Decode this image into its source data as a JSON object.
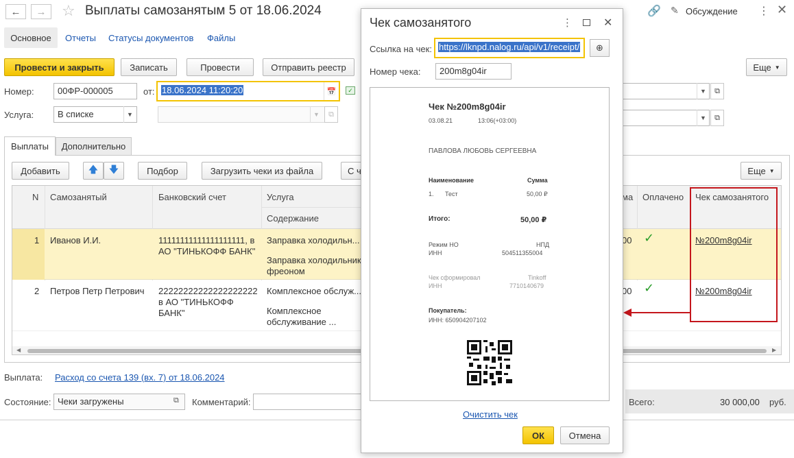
{
  "window": {
    "title": "Выплаты самозанятым 5 от 18.06.2024",
    "discussion_label": "Обсуждение"
  },
  "nav_tabs": [
    "Основное",
    "Отчеты",
    "Статусы документов",
    "Файлы"
  ],
  "toolbar": {
    "post_close": "Провести и закрыть",
    "save": "Записать",
    "post": "Провести",
    "send_registry": "Отправить реестр",
    "more": "Еще"
  },
  "form": {
    "number_label": "Номер:",
    "number_value": "00ФР-000005",
    "from_label": "от:",
    "date_value": "18.06.2024 11:20:20",
    "service_label": "Услуга:",
    "service_value": "В списке"
  },
  "tabs": [
    "Выплаты",
    "Дополнительно"
  ],
  "table_toolbar": {
    "add": "Добавить",
    "select": "Подбор",
    "load_checks": "Загрузить чеки из файла",
    "partial_c": "С ч",
    "more": "Еще"
  },
  "table": {
    "headers": {
      "n": "N",
      "selfemployed": "Самозанятый",
      "bank_account": "Банковский счет",
      "service": "Услуга",
      "content": "Содержание",
      "amount_partial": "ма",
      "paid": "Оплачено",
      "receipt": "Чек самозанятого"
    },
    "rows": [
      {
        "n": "1",
        "person": "Иванов И.И.",
        "account": "11111111111111111111, в АО \"ТИНЬКОФФ БАНК\"",
        "service": "Заправка холодильн...",
        "content": "Заправка холодильник фреоном",
        "amount_partial": "00",
        "receipt": "№200m8g04ir"
      },
      {
        "n": "2",
        "person": "Петров Петр Петрович",
        "account": "22222222222222222222 в АО \"ТИНЬКОФФ БАНК\"",
        "service": "Комплексное обслуж...",
        "content": "Комплексное обслуживание ...",
        "amount_partial": "00",
        "receipt": "№200m8g04ir"
      }
    ]
  },
  "footer": {
    "payment_label": "Выплата:",
    "payment_link": "Расход со счета 139 (вх. 7) от 18.06.2024",
    "state_label": "Состояние:",
    "state_value": "Чеки загружены",
    "comment_label": "Комментарий:",
    "total_label": "Всего:",
    "total_value": "30 000,00",
    "currency": "руб."
  },
  "dialog": {
    "title": "Чек самозанятого",
    "link_label": "Ссылка на чек:",
    "link_value": "https://lknpd.nalog.ru/api/v1/receipt/",
    "number_label": "Номер чека:",
    "number_value": "200m8g04ir",
    "clear_label": "Очистить чек",
    "ok": "ОК",
    "cancel": "Отмена"
  },
  "receipt": {
    "title": "Чек №200m8g04ir",
    "date": "03.08.21",
    "time": "13:06(+03:00)",
    "name": "ПАВЛОВА ЛЮБОВЬ СЕРГЕЕВНА",
    "col_name": "Наименование",
    "col_sum": "Сумма",
    "item_n": "1.",
    "item_name": "Тест",
    "item_sum": "50,00 ₽",
    "total_label": "Итого:",
    "total_value": "50,00 ₽",
    "mode_label": "Режим НО",
    "mode_value": "НПД",
    "inn_label": "ИНН",
    "inn_value": "504511355004",
    "formed_label": "Чек сформировал",
    "formed_value": "Tinkoff",
    "inn2_label": "ИНН",
    "inn2_value": "7710140679",
    "buyer_label": "Покупатель:",
    "buyer_inn": "ИНН: 650904207102"
  },
  "colors": {
    "accent_yellow": "#f3c300",
    "row_selected": "#fdf3c6",
    "link": "#1a56b0",
    "highlight_red": "#c4161c"
  }
}
